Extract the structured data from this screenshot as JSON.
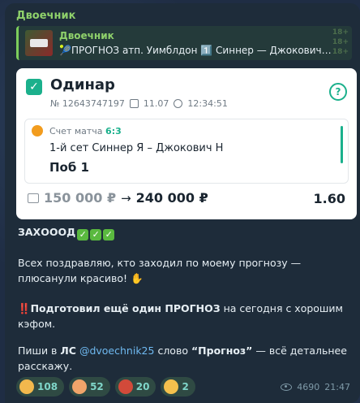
{
  "post": {
    "sender": "Двоечник",
    "reply": {
      "title": "Двоечник",
      "text": "🎾ПРОГНОЗ атп. Уимблдон 1️⃣ Синнер — Джокович П..."
    }
  },
  "bet_card": {
    "type": "Одинар",
    "number": "№ 12643747197",
    "date": "11.07",
    "time": "12:34:51",
    "score_label": "Счет матча",
    "score_value": "6:3",
    "match": "1-й сет Синнер Я – Джокович Н",
    "outcome": "Поб 1",
    "stake": "150 000 ₽",
    "arrow": "→",
    "win": "240 000 ₽",
    "odds": "1.60",
    "accent_color": "#1bb08c"
  },
  "message": {
    "line1": "ЗАХОООД",
    "line2": "Всех поздравляю, кто заходил по моему прогнозу — плюсанули красиво!",
    "line3_bangs": "‼️",
    "line3_bold": "Подготовил ещё один ПРОГНОЗ",
    "line3_rest": " на сегодня с хорошим кэфом.",
    "line4_prefix": "Пиши в ",
    "line4_ls": "ЛС",
    "line4_handle": "@dvoechnik25",
    "line4_word": " слово ",
    "line4_quote": "“Прогноз”",
    "line4_rest": " — всё детальнее расскажу."
  },
  "reactions": [
    {
      "count": "108",
      "icon": "smiling-face-icon"
    },
    {
      "count": "52",
      "icon": "face-icon"
    },
    {
      "count": "20",
      "icon": "red-face-icon"
    },
    {
      "count": "2",
      "icon": "cool-face-icon"
    }
  ],
  "footer": {
    "views": "4690",
    "time": "21:47"
  }
}
